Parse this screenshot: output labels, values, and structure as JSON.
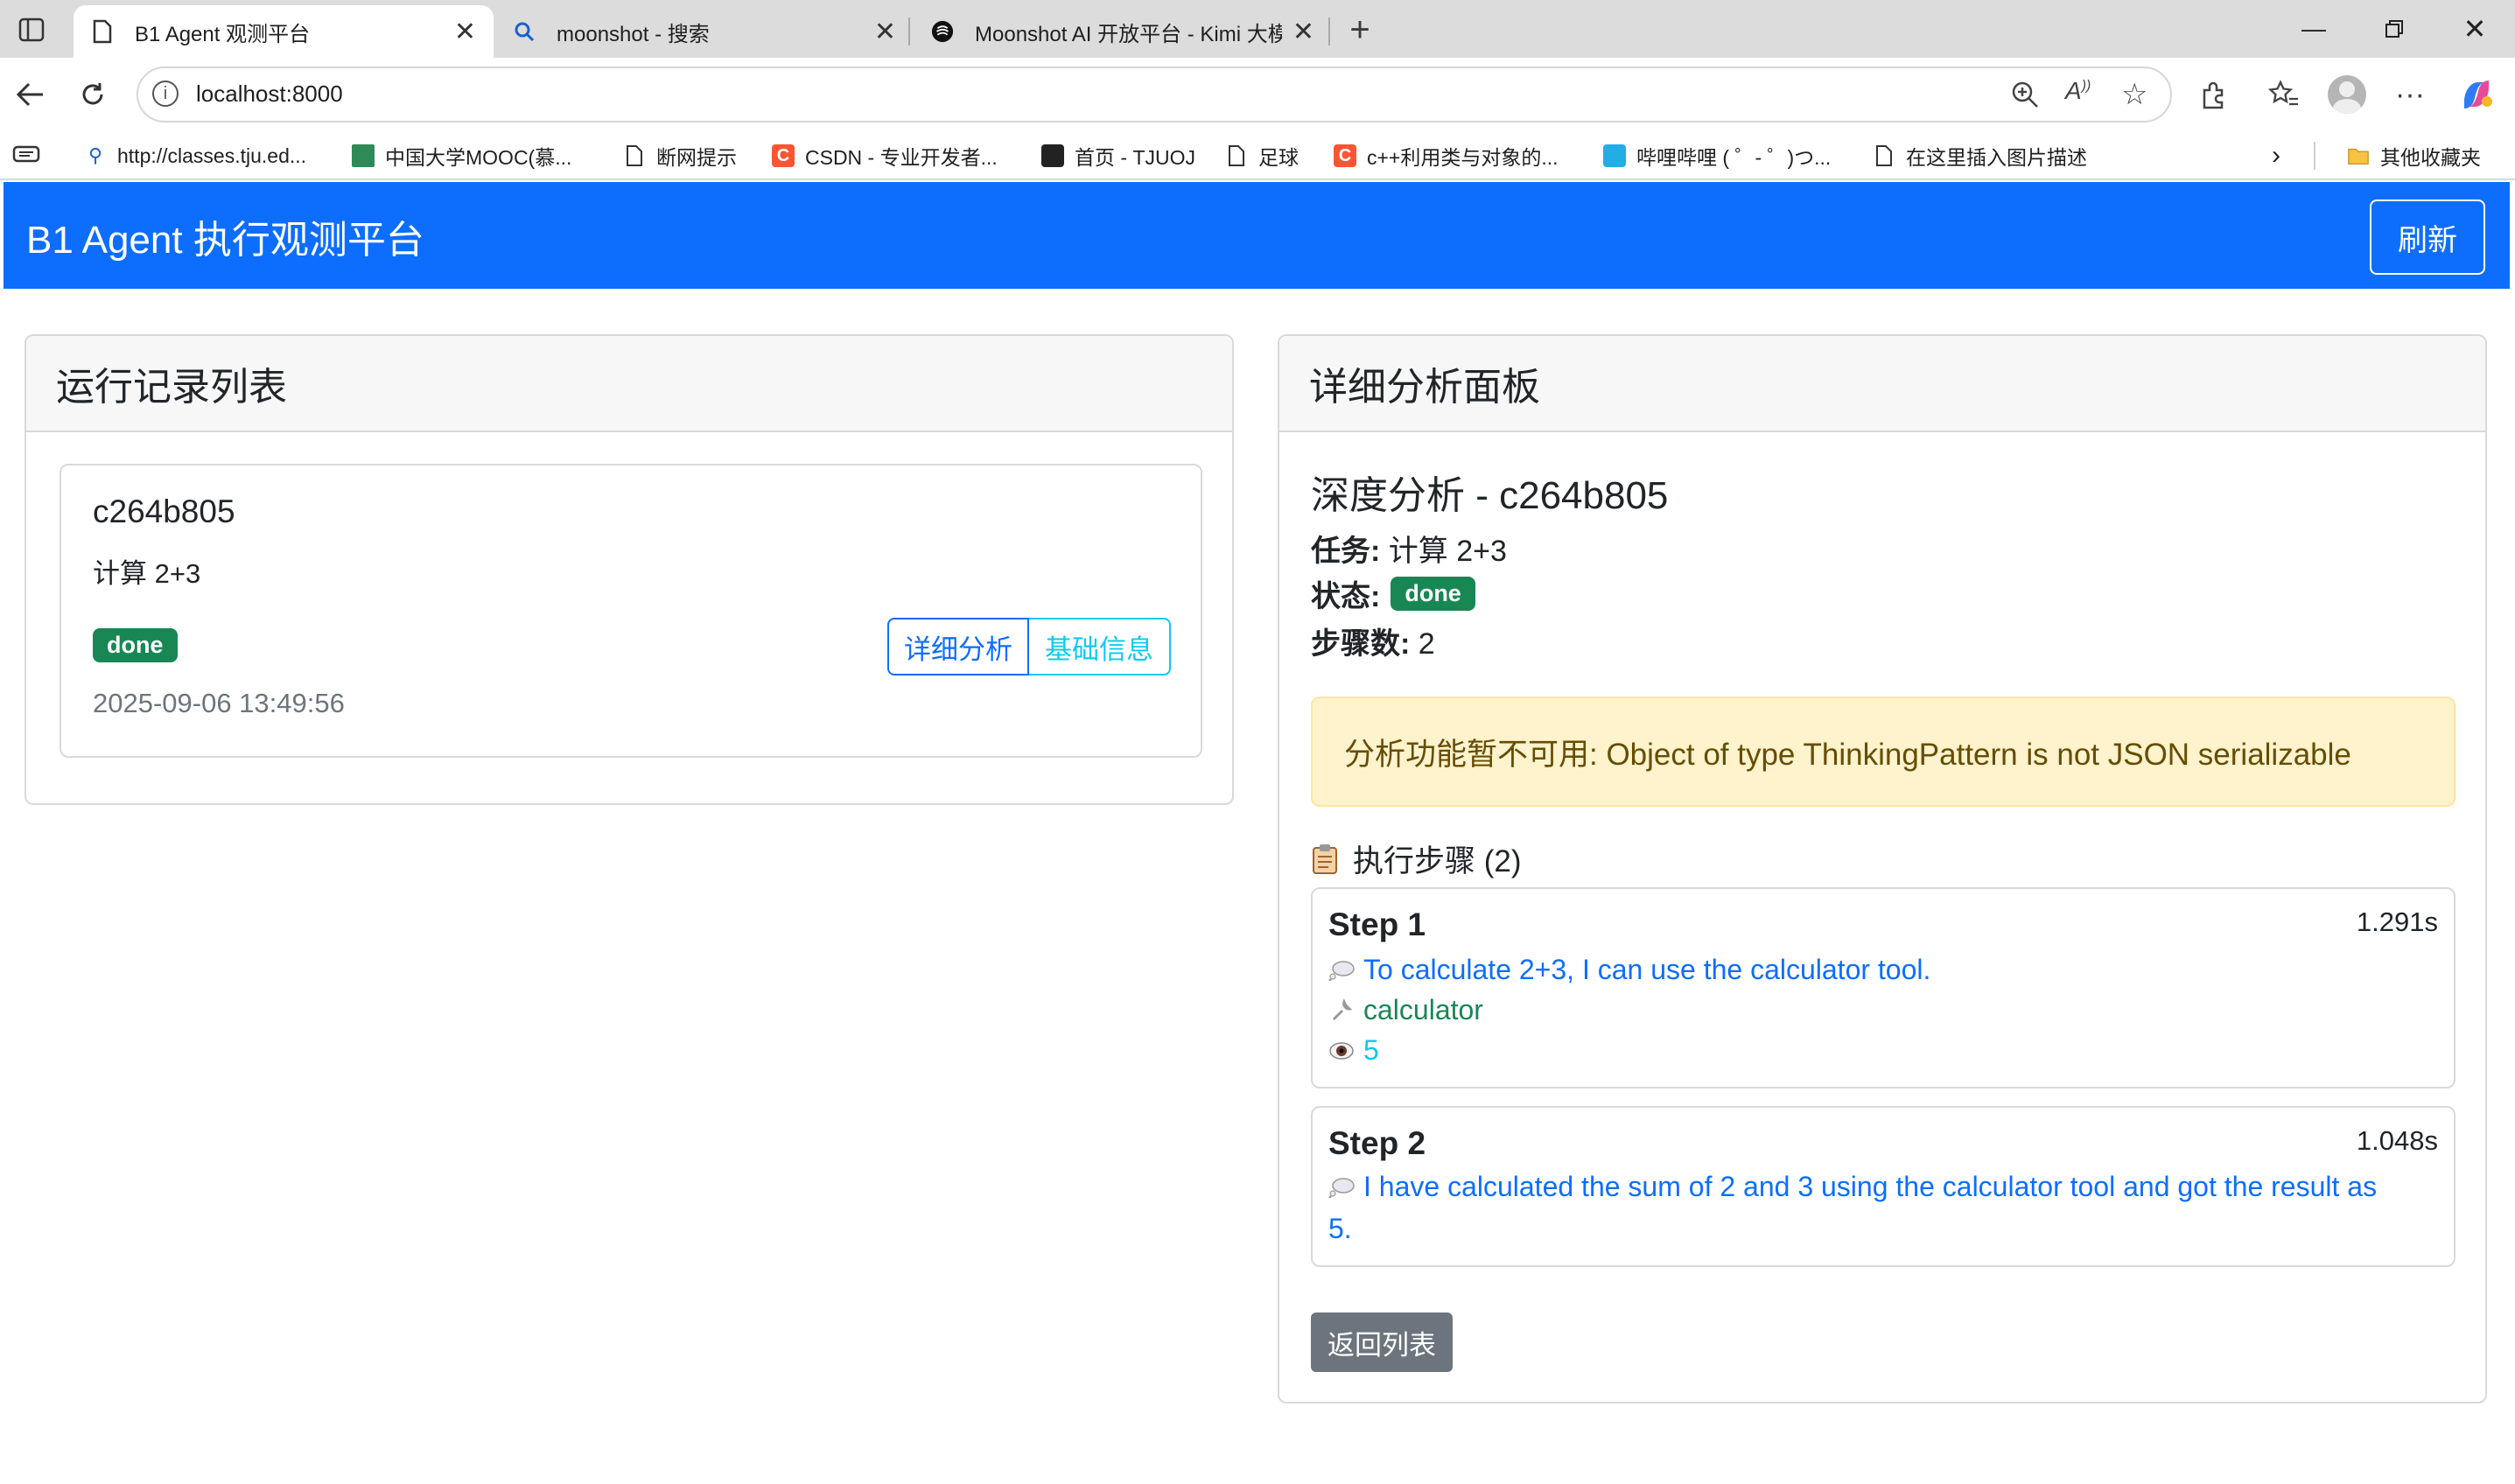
{
  "browser": {
    "tabs": [
      {
        "title": "B1 Agent 观测平台",
        "icon": "page-icon",
        "active": true
      },
      {
        "title": "moonshot - 搜索",
        "icon": "search-icon",
        "active": false
      },
      {
        "title": "Moonshot AI 开放平台 - Kimi 大模",
        "icon": "moonshot-icon",
        "active": false
      }
    ],
    "new_tab": "+",
    "address": "localhost:8000",
    "bookmarks": [
      "http://classes.tju.ed...",
      "中国大学MOOC(慕...",
      "断网提示",
      "CSDN - 专业开发者...",
      "首页 - TJUOJ",
      "足球",
      "c++利用类与对象的...",
      "哔哩哔哩 ( ゜- ゜)つ...",
      "在这里插入图片描述"
    ],
    "other_bookmarks": "其他收藏夹"
  },
  "app": {
    "brand": "B1 Agent 执行观测平台",
    "refresh_label": "刷新",
    "colors": {
      "primary": "#0d6efd",
      "success": "#198754",
      "info": "#0dcaf0",
      "warning_bg": "#fff3cd",
      "secondary": "#6c757d"
    }
  },
  "run_list": {
    "header": "运行记录列表",
    "items": [
      {
        "id": "c264b805",
        "task": "计算 2+3",
        "status": "done",
        "time": "2025-09-06 13:49:56",
        "detail_label": "详细分析",
        "basic_label": "基础信息"
      }
    ]
  },
  "detail": {
    "header": "详细分析面板",
    "title": "深度分析 - c264b805",
    "task_label": "任务:",
    "task_value": "计算 2+3",
    "status_label": "状态:",
    "status_value": "done",
    "steps_label": "步骤数:",
    "steps_value": "2",
    "alert": "分析功能暂不可用: Object of type ThinkingPattern is not JSON serializable",
    "steps_heading": "执行步骤 (2)",
    "steps": [
      {
        "title": "Step 1",
        "duration": "1.291s",
        "thought": "To calculate 2+3, I can use the calculator tool.",
        "tool": "calculator",
        "observation": "5"
      },
      {
        "title": "Step 2",
        "duration": "1.048s",
        "thought_line1": "I have calculated the sum of 2 and 3 using the calculator tool and got the result as",
        "thought_line2": "5."
      }
    ],
    "back_label": "返回列表"
  }
}
